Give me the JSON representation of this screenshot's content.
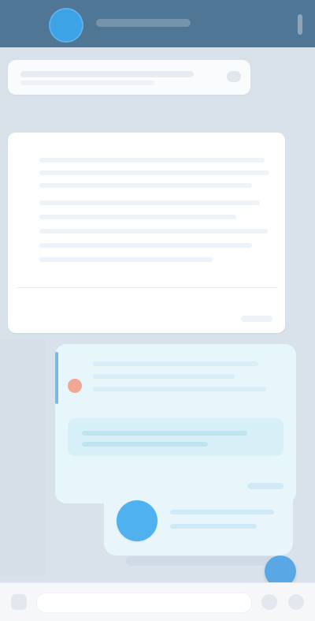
{
  "app": {
    "title": ""
  },
  "colors": {
    "top_bar": "#4f7694",
    "background": "#d9e2ea",
    "accent": "#3da3e7",
    "incoming_bubble": "#ffffff",
    "outgoing_bubble": "#e7f6fb"
  },
  "icons": {
    "avatar": "avatar",
    "menu": "more-vert-icon",
    "reply": "reply-icon",
    "play": "play-icon",
    "fab": "scroll-down-icon",
    "attach": "paperclip-icon",
    "emoji": "emoji-icon",
    "mic": "mic-icon"
  }
}
